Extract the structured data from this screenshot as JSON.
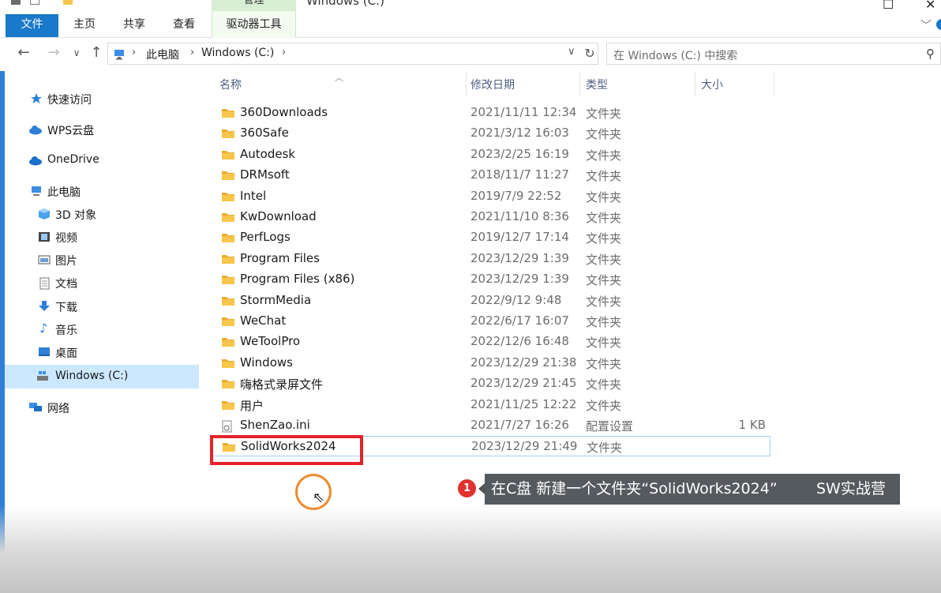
{
  "window": {
    "title": "Windows (C:)",
    "context_group": "管理"
  },
  "ribbon": {
    "tabs": [
      {
        "label": "文件"
      },
      {
        "label": "主页"
      },
      {
        "label": "共享"
      },
      {
        "label": "查看"
      },
      {
        "label": "驱动器工具"
      }
    ]
  },
  "address": {
    "crumbs": [
      "此电脑",
      "Windows (C:)"
    ],
    "search_placeholder": "在 Windows (C:) 中搜索"
  },
  "nav": {
    "items": [
      {
        "label": "快速访问",
        "icon": "star-icon"
      },
      {
        "label": "WPS云盘",
        "icon": "cloud-icon"
      },
      {
        "label": "OneDrive",
        "icon": "cloud-icon"
      },
      {
        "label": "此电脑",
        "icon": "computer-icon"
      },
      {
        "label": "3D 对象",
        "icon": "cube-icon"
      },
      {
        "label": "视频",
        "icon": "video-icon"
      },
      {
        "label": "图片",
        "icon": "image-icon"
      },
      {
        "label": "文档",
        "icon": "document-icon"
      },
      {
        "label": "下载",
        "icon": "download-icon"
      },
      {
        "label": "音乐",
        "icon": "music-icon"
      },
      {
        "label": "桌面",
        "icon": "desktop-icon"
      },
      {
        "label": "Windows (C:)",
        "icon": "drive-icon",
        "selected": true
      },
      {
        "label": "网络",
        "icon": "network-icon"
      }
    ]
  },
  "columns": {
    "name": "名称",
    "date": "修改日期",
    "type": "类型",
    "size": "大小"
  },
  "files": [
    {
      "name": "360Downloads",
      "date": "2021/11/11 12:34",
      "type": "文件夹",
      "size": ""
    },
    {
      "name": "360Safe",
      "date": "2021/3/12 16:03",
      "type": "文件夹",
      "size": ""
    },
    {
      "name": "Autodesk",
      "date": "2023/2/25 16:19",
      "type": "文件夹",
      "size": ""
    },
    {
      "name": "DRMsoft",
      "date": "2018/11/7 11:27",
      "type": "文件夹",
      "size": ""
    },
    {
      "name": "Intel",
      "date": "2019/7/9 22:52",
      "type": "文件夹",
      "size": ""
    },
    {
      "name": "KwDownload",
      "date": "2021/11/10 8:36",
      "type": "文件夹",
      "size": ""
    },
    {
      "name": "PerfLogs",
      "date": "2019/12/7 17:14",
      "type": "文件夹",
      "size": ""
    },
    {
      "name": "Program Files",
      "date": "2023/12/29 1:39",
      "type": "文件夹",
      "size": ""
    },
    {
      "name": "Program Files (x86)",
      "date": "2023/12/29 1:39",
      "type": "文件夹",
      "size": ""
    },
    {
      "name": "StormMedia",
      "date": "2022/9/12 9:48",
      "type": "文件夹",
      "size": ""
    },
    {
      "name": "WeChat",
      "date": "2022/6/17 16:07",
      "type": "文件夹",
      "size": ""
    },
    {
      "name": "WeToolPro",
      "date": "2022/12/6 16:48",
      "type": "文件夹",
      "size": ""
    },
    {
      "name": "Windows",
      "date": "2023/12/29 21:38",
      "type": "文件夹",
      "size": ""
    },
    {
      "name": "嗨格式录屏文件",
      "date": "2023/12/29 21:45",
      "type": "文件夹",
      "size": ""
    },
    {
      "name": "用户",
      "date": "2021/11/25 12:22",
      "type": "文件夹",
      "size": ""
    },
    {
      "name": "ShenZao.ini",
      "date": "2021/7/27 16:26",
      "type": "配置设置",
      "size": "1 KB"
    },
    {
      "name": "SolidWorks2024",
      "date": "2023/12/29 21:49",
      "type": "文件夹",
      "size": "",
      "focused": true
    }
  ],
  "caption": {
    "step": "1",
    "text": "在C盘 新建一个文件夹“SolidWorks2024”",
    "brand": "SW实战营"
  },
  "colors": {
    "accent": "#1979ca",
    "folder": "#f7c64b",
    "highlight": "#e5222a",
    "cursor_ring": "#f08a2c"
  }
}
